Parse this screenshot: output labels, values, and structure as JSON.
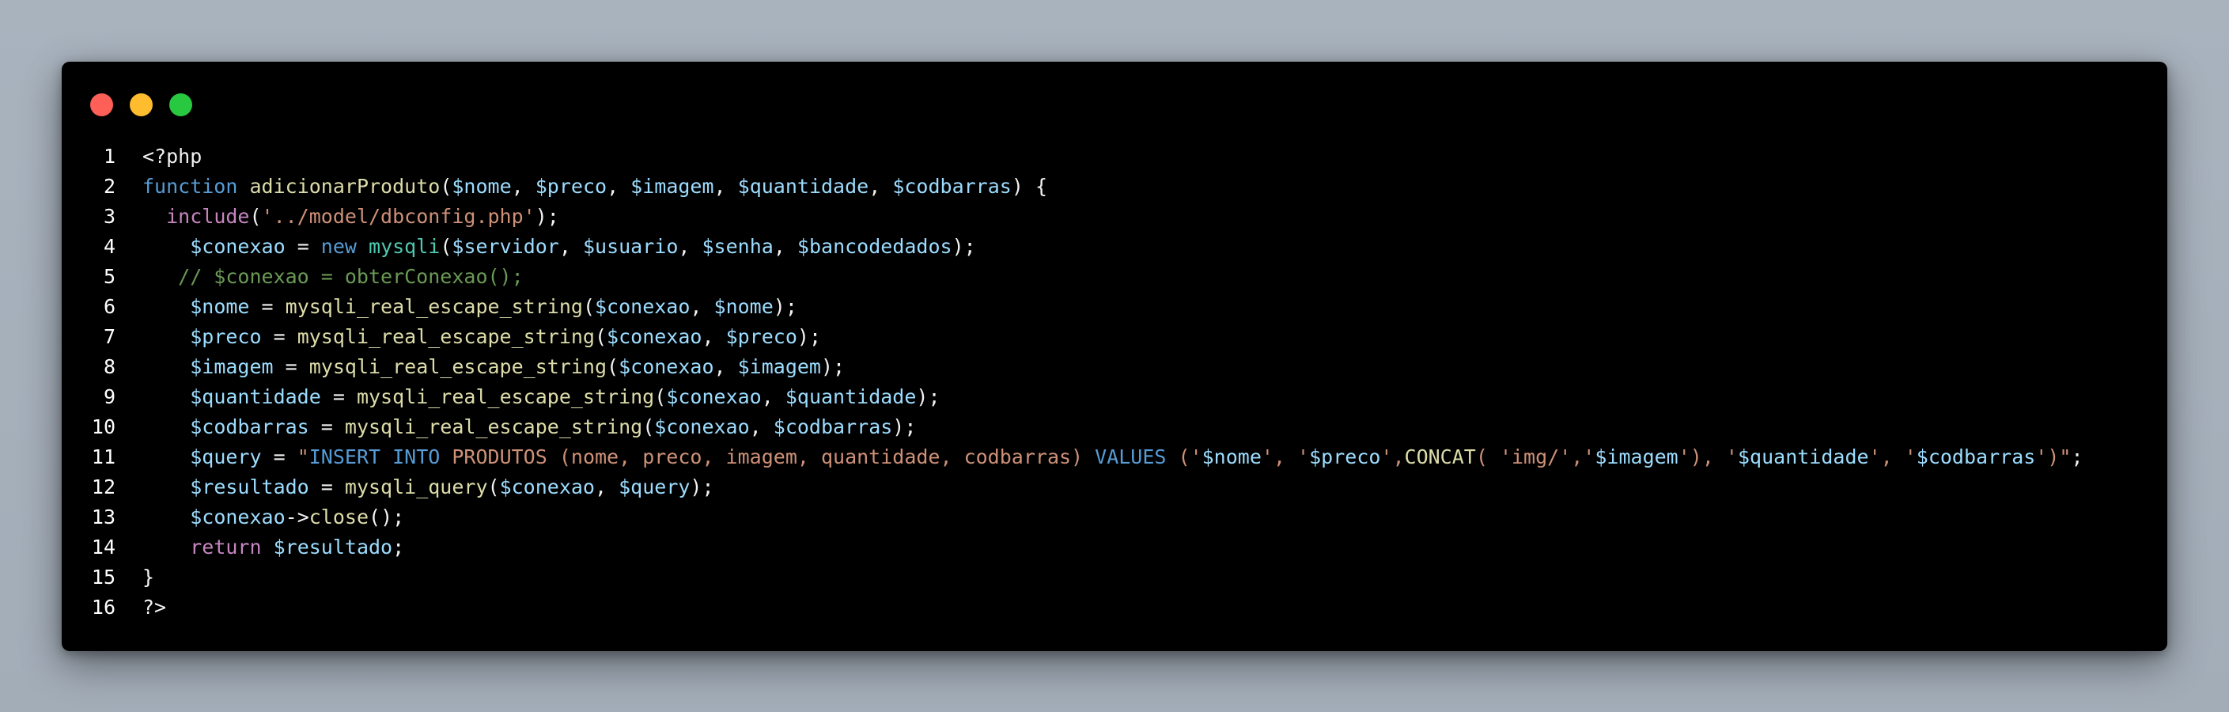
{
  "window": {
    "controls": [
      "close",
      "minimize",
      "maximize"
    ],
    "colors": {
      "close": "#fe5f57",
      "minimize": "#febc2e",
      "maximize": "#28c840",
      "background": "#000000"
    }
  },
  "code": {
    "language": "php",
    "lines": [
      {
        "n": "1",
        "tokens": [
          {
            "t": "plain",
            "v": "<?php"
          }
        ]
      },
      {
        "n": "2",
        "tokens": [
          {
            "t": "keyword",
            "v": "function"
          },
          {
            "t": "plain",
            "v": " "
          },
          {
            "t": "func",
            "v": "adicionarProduto"
          },
          {
            "t": "plain",
            "v": "("
          },
          {
            "t": "var",
            "v": "$nome"
          },
          {
            "t": "plain",
            "v": ", "
          },
          {
            "t": "var",
            "v": "$preco"
          },
          {
            "t": "plain",
            "v": ", "
          },
          {
            "t": "var",
            "v": "$imagem"
          },
          {
            "t": "plain",
            "v": ", "
          },
          {
            "t": "var",
            "v": "$quantidade"
          },
          {
            "t": "plain",
            "v": ", "
          },
          {
            "t": "var",
            "v": "$codbarras"
          },
          {
            "t": "plain",
            "v": ") {"
          }
        ]
      },
      {
        "n": "3",
        "tokens": [
          {
            "t": "plain",
            "v": "  "
          },
          {
            "t": "ctrl",
            "v": "include"
          },
          {
            "t": "plain",
            "v": "("
          },
          {
            "t": "string",
            "v": "'../model/dbconfig.php'"
          },
          {
            "t": "plain",
            "v": ");"
          }
        ]
      },
      {
        "n": "4",
        "tokens": [
          {
            "t": "plain",
            "v": "    "
          },
          {
            "t": "var",
            "v": "$conexao"
          },
          {
            "t": "plain",
            "v": " = "
          },
          {
            "t": "keyword",
            "v": "new"
          },
          {
            "t": "plain",
            "v": " "
          },
          {
            "t": "class",
            "v": "mysqli"
          },
          {
            "t": "plain",
            "v": "("
          },
          {
            "t": "var",
            "v": "$servidor"
          },
          {
            "t": "plain",
            "v": ", "
          },
          {
            "t": "var",
            "v": "$usuario"
          },
          {
            "t": "plain",
            "v": ", "
          },
          {
            "t": "var",
            "v": "$senha"
          },
          {
            "t": "plain",
            "v": ", "
          },
          {
            "t": "var",
            "v": "$bancodedados"
          },
          {
            "t": "plain",
            "v": ");"
          }
        ]
      },
      {
        "n": "5",
        "tokens": [
          {
            "t": "plain",
            "v": "   "
          },
          {
            "t": "comment",
            "v": "// $conexao = obterConexao();"
          }
        ]
      },
      {
        "n": "6",
        "tokens": [
          {
            "t": "plain",
            "v": "    "
          },
          {
            "t": "var",
            "v": "$nome"
          },
          {
            "t": "plain",
            "v": " = "
          },
          {
            "t": "func",
            "v": "mysqli_real_escape_string"
          },
          {
            "t": "plain",
            "v": "("
          },
          {
            "t": "var",
            "v": "$conexao"
          },
          {
            "t": "plain",
            "v": ", "
          },
          {
            "t": "var",
            "v": "$nome"
          },
          {
            "t": "plain",
            "v": ");"
          }
        ]
      },
      {
        "n": "7",
        "tokens": [
          {
            "t": "plain",
            "v": "    "
          },
          {
            "t": "var",
            "v": "$preco"
          },
          {
            "t": "plain",
            "v": " = "
          },
          {
            "t": "func",
            "v": "mysqli_real_escape_string"
          },
          {
            "t": "plain",
            "v": "("
          },
          {
            "t": "var",
            "v": "$conexao"
          },
          {
            "t": "plain",
            "v": ", "
          },
          {
            "t": "var",
            "v": "$preco"
          },
          {
            "t": "plain",
            "v": ");"
          }
        ]
      },
      {
        "n": "8",
        "tokens": [
          {
            "t": "plain",
            "v": "    "
          },
          {
            "t": "var",
            "v": "$imagem"
          },
          {
            "t": "plain",
            "v": " = "
          },
          {
            "t": "func",
            "v": "mysqli_real_escape_string"
          },
          {
            "t": "plain",
            "v": "("
          },
          {
            "t": "var",
            "v": "$conexao"
          },
          {
            "t": "plain",
            "v": ", "
          },
          {
            "t": "var",
            "v": "$imagem"
          },
          {
            "t": "plain",
            "v": ");"
          }
        ]
      },
      {
        "n": "9",
        "tokens": [
          {
            "t": "plain",
            "v": "    "
          },
          {
            "t": "var",
            "v": "$quantidade"
          },
          {
            "t": "plain",
            "v": " = "
          },
          {
            "t": "func",
            "v": "mysqli_real_escape_string"
          },
          {
            "t": "plain",
            "v": "("
          },
          {
            "t": "var",
            "v": "$conexao"
          },
          {
            "t": "plain",
            "v": ", "
          },
          {
            "t": "var",
            "v": "$quantidade"
          },
          {
            "t": "plain",
            "v": ");"
          }
        ]
      },
      {
        "n": "10",
        "tokens": [
          {
            "t": "plain",
            "v": "    "
          },
          {
            "t": "var",
            "v": "$codbarras"
          },
          {
            "t": "plain",
            "v": " = "
          },
          {
            "t": "func",
            "v": "mysqli_real_escape_string"
          },
          {
            "t": "plain",
            "v": "("
          },
          {
            "t": "var",
            "v": "$conexao"
          },
          {
            "t": "plain",
            "v": ", "
          },
          {
            "t": "var",
            "v": "$codbarras"
          },
          {
            "t": "plain",
            "v": ");"
          }
        ]
      },
      {
        "n": "11",
        "tokens": [
          {
            "t": "plain",
            "v": "    "
          },
          {
            "t": "var",
            "v": "$query"
          },
          {
            "t": "plain",
            "v": " = "
          },
          {
            "t": "string",
            "v": "\""
          },
          {
            "t": "sql",
            "v": "INSERT INTO"
          },
          {
            "t": "string",
            "v": " PRODUTOS (nome, preco, imagem, quantidade, codbarras) "
          },
          {
            "t": "sql",
            "v": "VALUES"
          },
          {
            "t": "string",
            "v": " ('"
          },
          {
            "t": "var",
            "v": "$nome"
          },
          {
            "t": "string",
            "v": "', '"
          },
          {
            "t": "var",
            "v": "$preco"
          },
          {
            "t": "string",
            "v": "',"
          },
          {
            "t": "func",
            "v": "CONCAT"
          },
          {
            "t": "string",
            "v": "( 'img/','"
          },
          {
            "t": "var",
            "v": "$imagem"
          },
          {
            "t": "string",
            "v": "'), '"
          },
          {
            "t": "var",
            "v": "$quantidade"
          },
          {
            "t": "string",
            "v": "', '"
          },
          {
            "t": "var",
            "v": "$codbarras"
          },
          {
            "t": "string",
            "v": "')\""
          },
          {
            "t": "plain",
            "v": ";"
          }
        ]
      },
      {
        "n": "12",
        "tokens": [
          {
            "t": "plain",
            "v": "    "
          },
          {
            "t": "var",
            "v": "$resultado"
          },
          {
            "t": "plain",
            "v": " = "
          },
          {
            "t": "func",
            "v": "mysqli_query"
          },
          {
            "t": "plain",
            "v": "("
          },
          {
            "t": "var",
            "v": "$conexao"
          },
          {
            "t": "plain",
            "v": ", "
          },
          {
            "t": "var",
            "v": "$query"
          },
          {
            "t": "plain",
            "v": ");"
          }
        ]
      },
      {
        "n": "13",
        "tokens": [
          {
            "t": "plain",
            "v": "    "
          },
          {
            "t": "var",
            "v": "$conexao"
          },
          {
            "t": "plain",
            "v": "->"
          },
          {
            "t": "func",
            "v": "close"
          },
          {
            "t": "plain",
            "v": "();"
          }
        ]
      },
      {
        "n": "14",
        "tokens": [
          {
            "t": "plain",
            "v": "    "
          },
          {
            "t": "ctrl",
            "v": "return"
          },
          {
            "t": "plain",
            "v": " "
          },
          {
            "t": "var",
            "v": "$resultado"
          },
          {
            "t": "plain",
            "v": ";"
          }
        ]
      },
      {
        "n": "15",
        "tokens": [
          {
            "t": "plain",
            "v": "}"
          }
        ]
      },
      {
        "n": "16",
        "tokens": [
          {
            "t": "plain",
            "v": "?>"
          }
        ]
      }
    ]
  }
}
